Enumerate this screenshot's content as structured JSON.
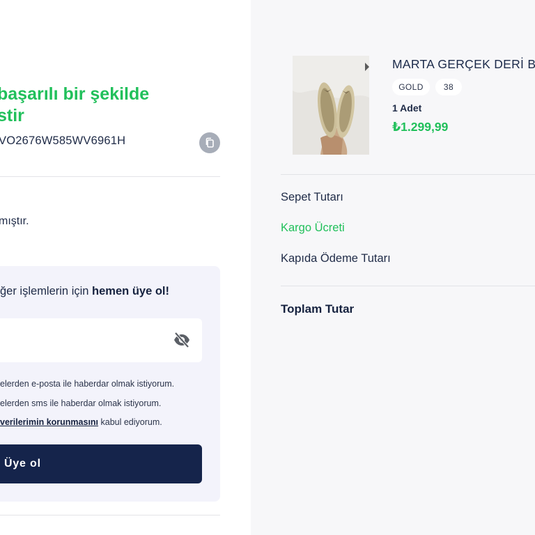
{
  "colors": {
    "accent_green": "#21c05b",
    "navy": "#15244b",
    "panel_bg": "#f7f7f9",
    "register_bg": "#f3f3fb"
  },
  "order": {
    "success_title": "başarılı bir şekilde\nstir",
    "code": "VO2676W585WV6961H",
    "note": "mıştır."
  },
  "register": {
    "text_prefix": "ğer işlemlerin için ",
    "text_bold": "hemen üye ol!",
    "password_placeholder": "",
    "consent_email": "elerden e-posta ile haberdar olmak istiyorum.",
    "consent_sms": "elerden sms ile haberdar olmak istiyorum.",
    "consent_privacy_link": "verilerimin korunmasını",
    "consent_privacy_suffix": " kabul ediyorum.",
    "button_label": "Üye ol"
  },
  "product": {
    "name": "MARTA GERÇEK DERİ BA",
    "color_chip": "GOLD",
    "size_chip": "38",
    "quantity": "1 Adet",
    "price": "₺1.299,99"
  },
  "summary": {
    "basket_label": "Sepet Tutarı",
    "shipping_label": "Kargo Ücreti",
    "cod_label": "Kapıda Ödeme Tutarı",
    "total_label": "Toplam Tutar"
  },
  "icons": {
    "copy": "copy-icon",
    "eye_off": "eye-off-icon",
    "product_image": "product-image"
  }
}
